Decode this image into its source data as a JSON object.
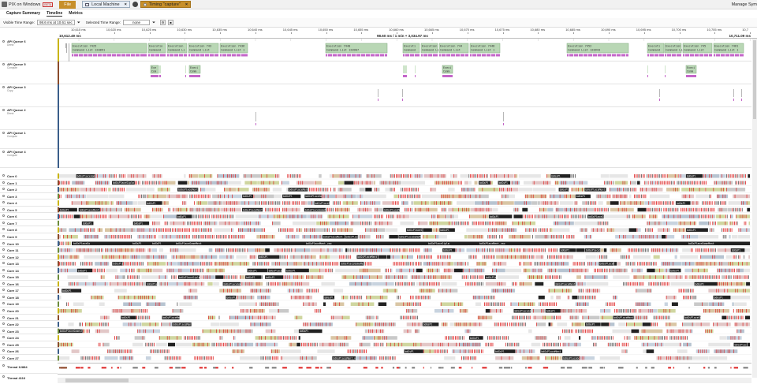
{
  "titlebar": {
    "app_title": "PIX on Windows",
    "beta": "BETA",
    "file_tab": "File",
    "connection_tab": "Local Machine",
    "capture_tab": "Timing \"capture\"",
    "right_text": "Manage Sym"
  },
  "menu": {
    "items": [
      "Capture Summary",
      "Timeline",
      "Metrics"
    ],
    "active": "Timeline"
  },
  "toolbar": {
    "visible_range_label": "Visible Time Range:",
    "visible_range_value": "98.6 ms at 10.61 sec",
    "selected_range_label": "Selected Time Range:",
    "selected_range_value": "none"
  },
  "ruler": {
    "start": "10,612.49 ms",
    "mid": "98.60 ms / 1 min + 3,034.97 ms",
    "end": "10,711.09 ms",
    "ticks": [
      "10,615 ms",
      "10,620 ms",
      "10,625 ms",
      "10,630 ms",
      "10,635 ms",
      "10,640 ms",
      "10,645 ms",
      "10,650 ms",
      "10,655 ms",
      "10,660 ms",
      "10,665 ms",
      "10,670 ms",
      "10,675 ms",
      "10,680 ms",
      "10,685 ms",
      "10,690 ms",
      "10,695 ms",
      "10,700 ms",
      "10,705 ms",
      "10,7"
    ]
  },
  "queues": [
    {
      "name": "API Queue 6",
      "sub": "Direct"
    },
    {
      "name": "API Queue 5",
      "sub": "Compute"
    },
    {
      "name": "API Queue 3",
      "sub": "Copy"
    },
    {
      "name": "API Queue 2",
      "sub": "Direct"
    },
    {
      "name": "API Queue 1",
      "sub": "Compute"
    },
    {
      "name": "API Queue 4",
      "sub": "Compute"
    }
  ],
  "cores": [
    "Core 0",
    "Core 1",
    "Core 2",
    "Core 3",
    "Core 4",
    "Core 5",
    "Core 6",
    "Core 7",
    "Core 8",
    "Core 9",
    "Core 10",
    "Core 11",
    "Core 12",
    "Core 13",
    "Core 14",
    "Core 15",
    "Core 16",
    "Core 17",
    "Core 18",
    "Core 19",
    "Core 20",
    "Core 21",
    "Core 22",
    "Core 23",
    "Core 24",
    "Core 25",
    "Core 26",
    "Core 27"
  ],
  "threads": [
    "Thread 12884",
    "Thread 4116"
  ],
  "q6_blocks": [
    {
      "l1": "Execution 7425",
      "l2": "Command List 120891"
    },
    {
      "l1": "Executio",
      "l2": "Command"
    },
    {
      "l1": "Execution",
      "l2": "Command Li"
    },
    {
      "l1": "Execution 743",
      "l2": "Command List"
    },
    {
      "l1": "Execution 7436",
      "l2": "Command List 1"
    },
    {
      "l1": "Execution 7440",
      "l2": "Command List 120907"
    },
    {
      "l1": "Executi",
      "l2": "Command"
    },
    {
      "l1": "Execution",
      "l2": "Command Li"
    },
    {
      "l1": "Execution 744",
      "l2": "Command List"
    },
    {
      "l1": "Execution 7448",
      "l2": "Command List 1"
    },
    {
      "l1": "Execution 7452",
      "l2": "Command List 120943"
    },
    {
      "l1": "Executi",
      "l2": "Command"
    },
    {
      "l1": "Execution",
      "l2": "Command Li"
    },
    {
      "l1": "Execution 745",
      "l2": "Command List"
    },
    {
      "l1": "Execution 7461",
      "l2": "Command List 1"
    }
  ],
  "q5_blocks": [
    {
      "l1": "Exe",
      "l2": "Com"
    },
    {
      "l1": "Execi",
      "l2": "Comm"
    },
    {
      "l1": "Execi",
      "l2": "Comm"
    },
    {
      "l1": "Execi",
      "l2": "Comm"
    }
  ],
  "core_labels": [
    "bdGsPlaceGomeCT",
    "bdGsPl",
    "bdGsPl",
    "bdGsPlaceSiplm",
    "bdGsPl",
    "bdGsPl",
    "bdGsPlaceMent",
    "bdGsPlaceMent_vax",
    "bdGsPlaceGomeMent",
    "bdGsPlaceMent_vax",
    "bdGsPl",
    "bdGsPl"
  ],
  "colors": {
    "accent": "#c78f2a",
    "exec_block": "#b9d7b5",
    "exec_border": "#7fa87a",
    "magenta": "#c466c9",
    "gray": "#9a9a9a",
    "red": "#d22",
    "dark": "#222"
  }
}
